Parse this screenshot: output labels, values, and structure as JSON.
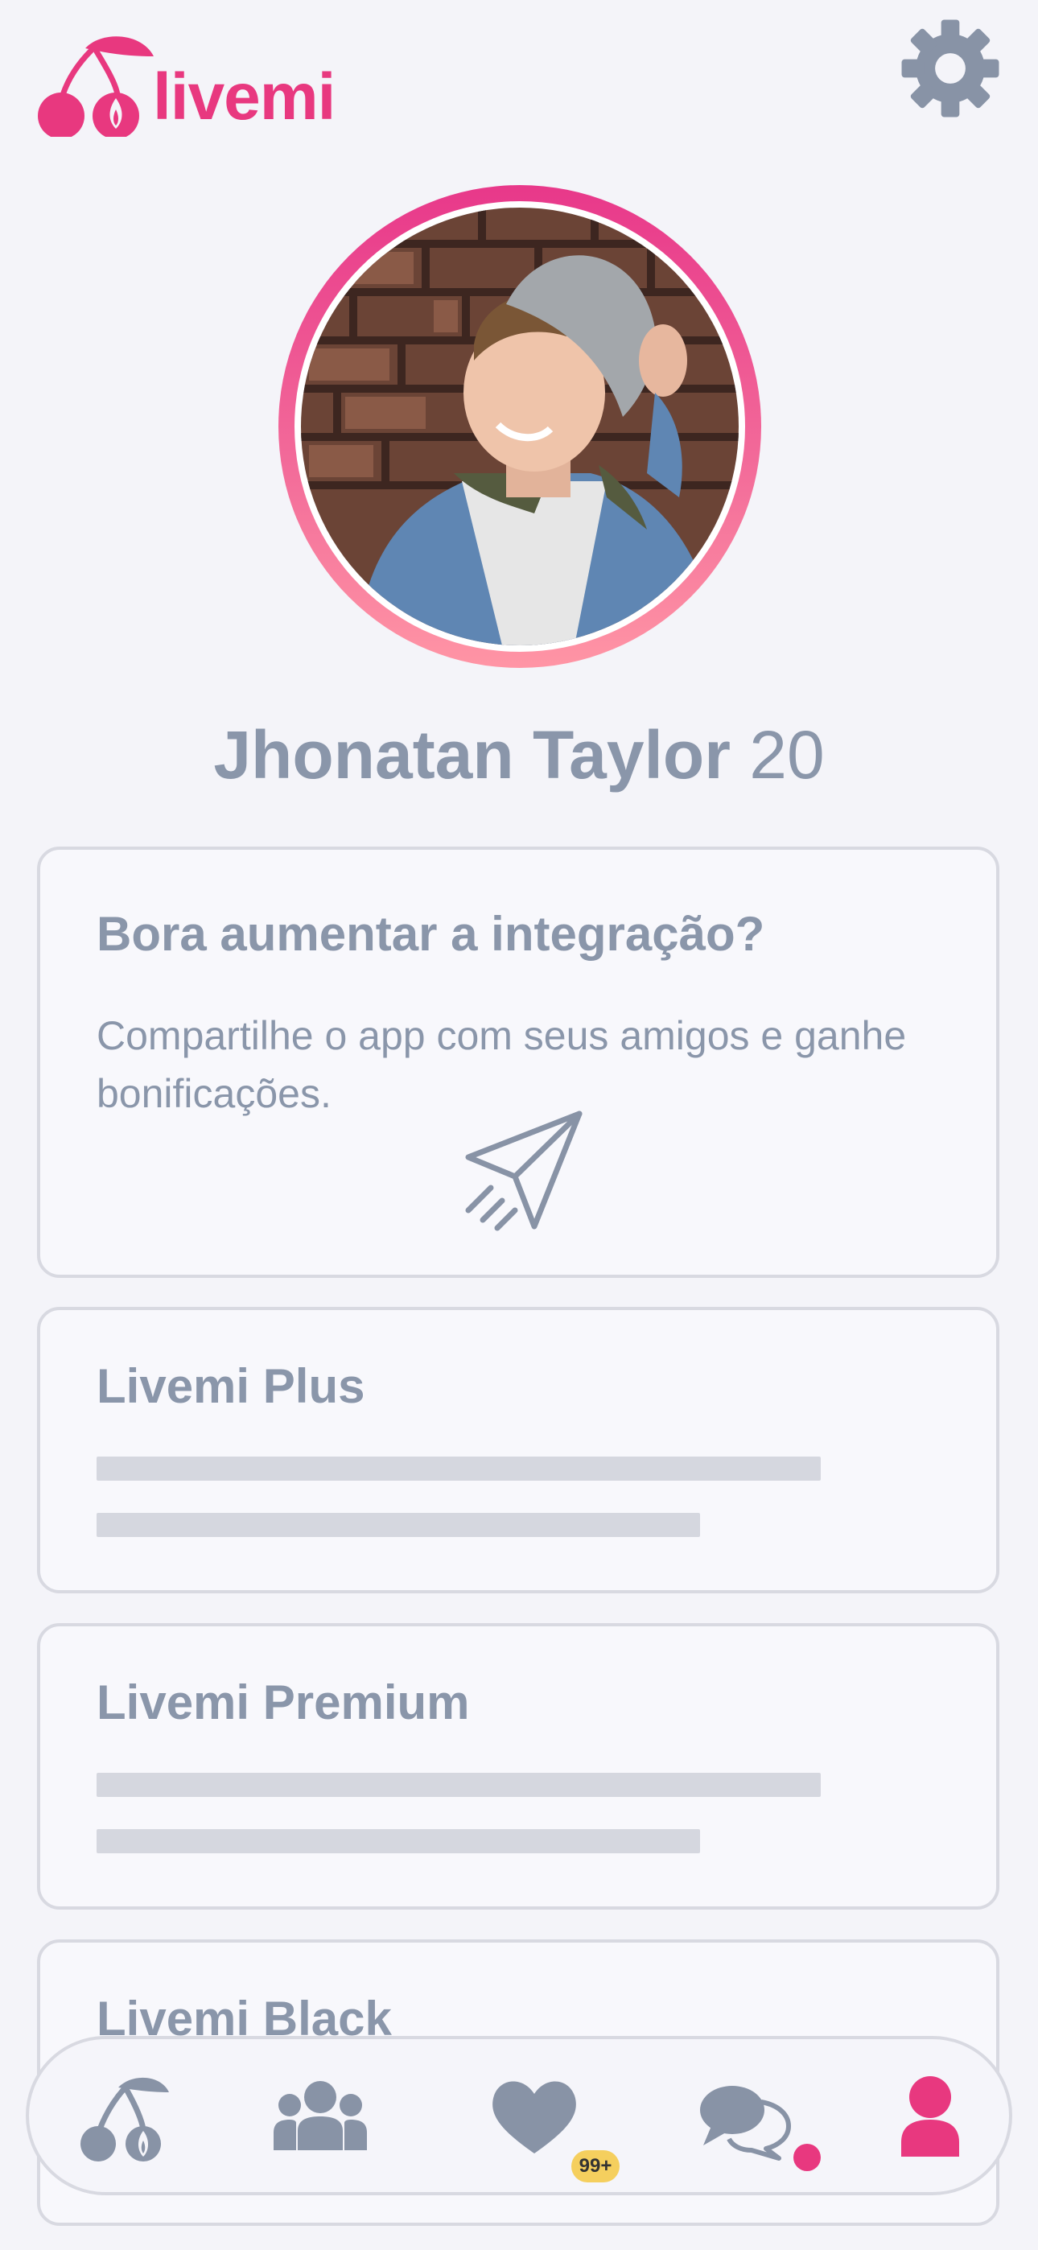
{
  "app": {
    "brand": "livemi",
    "accent_color": "#e8387f",
    "text_color": "#8a96aa"
  },
  "header": {
    "logo_icon": "cherry-flame-icon",
    "settings_icon": "gear-icon"
  },
  "profile": {
    "name": "Jhonatan Taylor",
    "age": "20"
  },
  "cards": {
    "share": {
      "title": "Bora aumentar a integração?",
      "description": "Compartilhe o app com seus amigos e ganhe bonificações.",
      "icon": "paper-plane-icon"
    },
    "plus": {
      "title": "Livemi Plus"
    },
    "premium": {
      "title": "Livemi Premium"
    },
    "black": {
      "title": "Livemi Black"
    }
  },
  "bottom_nav": {
    "items": [
      {
        "icon": "cherry-icon",
        "active": false
      },
      {
        "icon": "group-icon",
        "active": false
      },
      {
        "icon": "heart-icon",
        "active": false,
        "badge": "99+"
      },
      {
        "icon": "chat-icon",
        "active": false,
        "has_dot": true
      },
      {
        "icon": "profile-icon",
        "active": true
      }
    ]
  }
}
